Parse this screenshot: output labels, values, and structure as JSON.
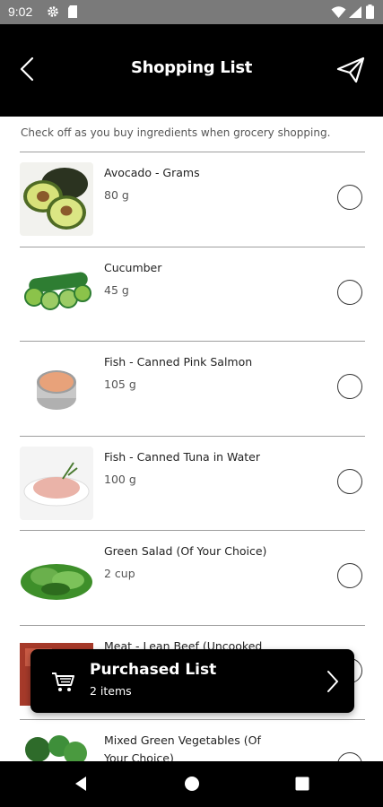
{
  "status_bar": {
    "time": "9:02"
  },
  "header": {
    "title": "Shopping List"
  },
  "hint": "Check off as you buy ingredients when grocery shopping.",
  "items": [
    {
      "name": "Avocado - Grams",
      "qty": "80 g"
    },
    {
      "name": "Cucumber",
      "qty": "45 g"
    },
    {
      "name": "Fish - Canned Pink Salmon",
      "qty": "105 g"
    },
    {
      "name": "Fish - Canned Tuna in Water",
      "qty": "100 g"
    },
    {
      "name": "Green Salad (Of Your Choice)",
      "qty": "2 cup"
    },
    {
      "name": "Meat - Lean Beef (Uncooked",
      "qty": ""
    },
    {
      "name": "Mixed Green Vegetables (Of Your Choice)",
      "qty": ""
    }
  ],
  "purchased": {
    "title": "Purchased List",
    "count": "2 items"
  },
  "colors": {
    "app_bar": "#000000",
    "status_bar": "#7a7a7a",
    "divider": "#9e9e9e"
  }
}
